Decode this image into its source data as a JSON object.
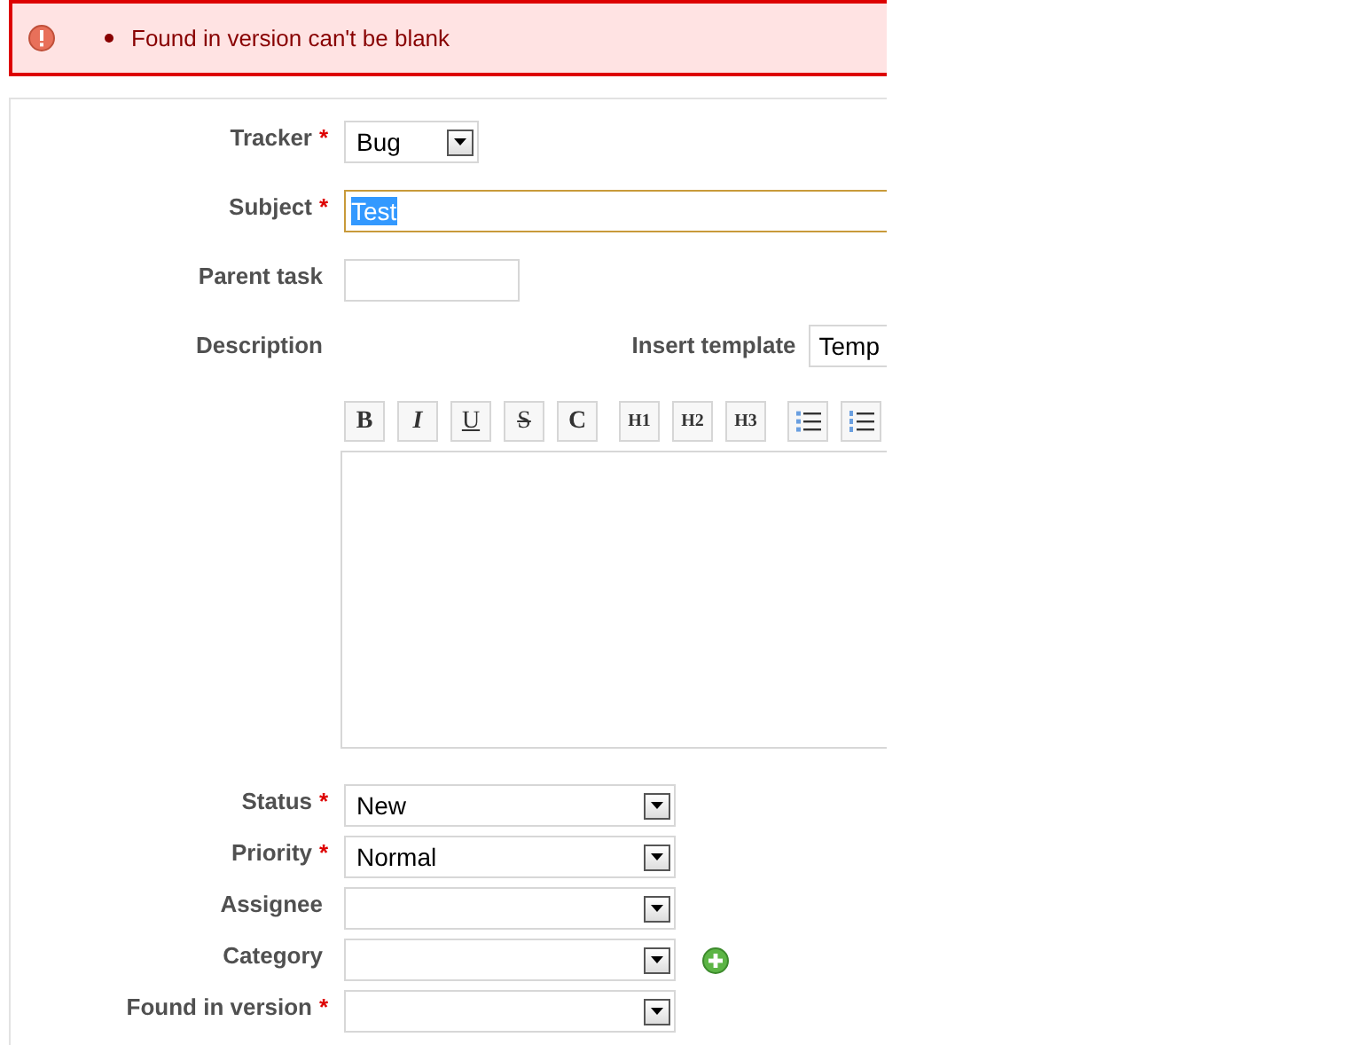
{
  "error": {
    "messages": [
      "Found in version can't be blank"
    ]
  },
  "required_mark": "*",
  "fields_top": [
    {
      "label": "Tracker",
      "required": true,
      "kind": "short-select",
      "value": "Bug",
      "highlighted": false
    },
    {
      "label": "Subject",
      "required": true,
      "kind": "wide-text",
      "value": "Test",
      "highlighted": true
    },
    {
      "label": "Parent task",
      "required": false,
      "kind": "short-text",
      "highlighted": false
    }
  ],
  "description": {
    "label": "Description",
    "template_label": "Insert template",
    "template_value": "Temp",
    "toolbar": [
      {
        "kind": "bold",
        "label": "B"
      },
      {
        "kind": "italic",
        "label": "I"
      },
      {
        "kind": "underline",
        "label": "U"
      },
      {
        "kind": "strike",
        "label": "S"
      },
      {
        "kind": "code",
        "label": "C"
      },
      {
        "kind": "heading",
        "label": "H1"
      },
      {
        "kind": "heading",
        "label": "H2"
      },
      {
        "kind": "heading",
        "label": "H3"
      },
      {
        "kind": "bullet-list"
      },
      {
        "kind": "numbered-list"
      }
    ]
  },
  "fields_bottom": [
    {
      "label": "Status",
      "required": true,
      "kind": "select",
      "value": "New",
      "add_button": false
    },
    {
      "label": "Priority",
      "required": true,
      "kind": "select",
      "value": "Normal",
      "add_button": false
    },
    {
      "label": "Assignee",
      "required": false,
      "kind": "select",
      "add_button": false
    },
    {
      "label": "Category",
      "required": false,
      "kind": "select",
      "add_button": true
    },
    {
      "label": "Found in version",
      "required": true,
      "kind": "select",
      "add_button": false
    }
  ]
}
